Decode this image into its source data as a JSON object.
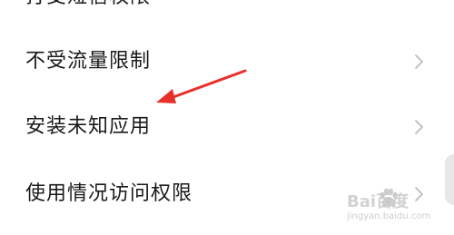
{
  "settings_list": {
    "items": [
      {
        "label": "打受短信权限"
      },
      {
        "label": "不受流量限制"
      },
      {
        "label": "安装未知应用"
      },
      {
        "label": "使用情况访问权限"
      }
    ]
  },
  "icons": {
    "row_chevron": "chevron-right-icon",
    "annotation": "red-arrow-annotation",
    "watermark_logo": "baidu-paw-icon"
  },
  "colors": {
    "annotation_red": "#e8302a",
    "chevron_gray": "#bbbbbb",
    "text": "#1a1a1a"
  },
  "watermark": {
    "brand": "Bai百度",
    "sub": "jingyan.baidu.com"
  }
}
